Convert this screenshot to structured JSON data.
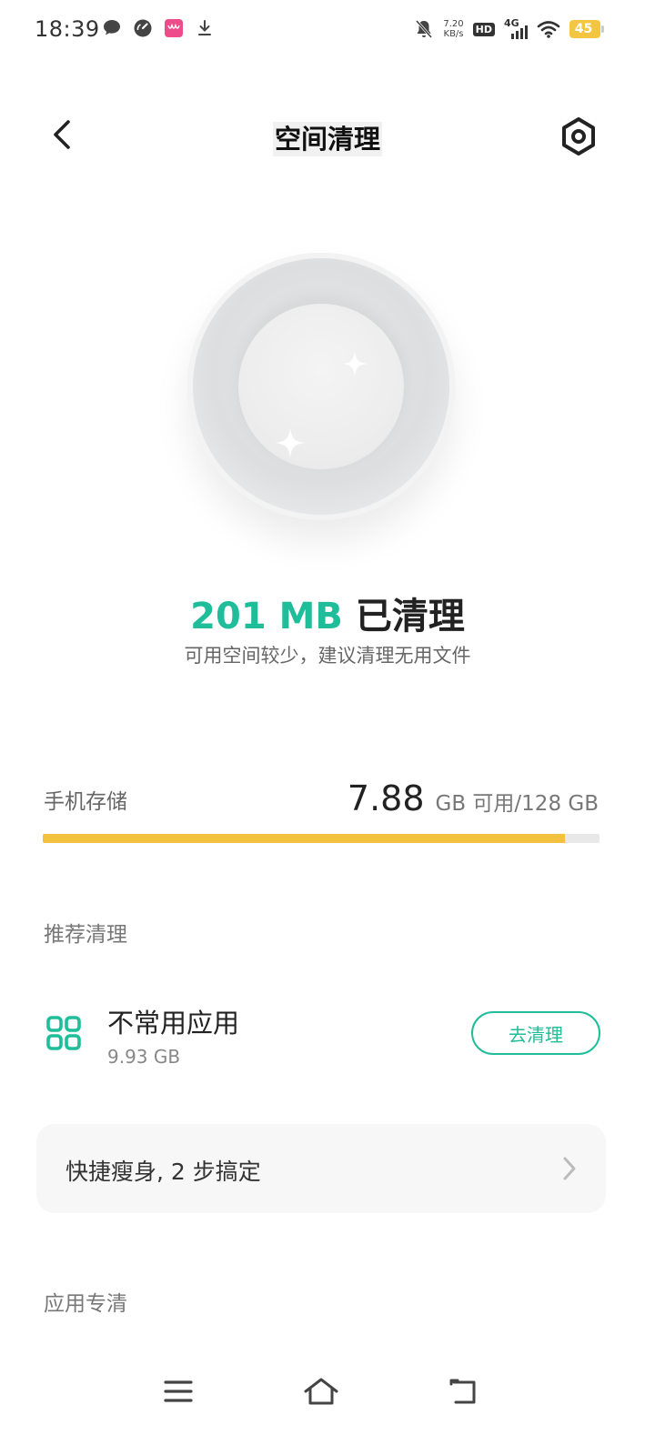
{
  "status_bar": {
    "time": "18:39",
    "speed_value": "7.20",
    "speed_unit": "KB/s",
    "hd": "HD",
    "network": "4G",
    "battery": "45",
    "left_icons": [
      "message-icon",
      "gauge-icon",
      "app-notification-icon",
      "download-icon"
    ],
    "right_icons": [
      "mute-icon",
      "hd-icon",
      "signal-icon",
      "wifi-icon",
      "battery-icon"
    ]
  },
  "header": {
    "title": "空间清理",
    "back_icon": "back-arrow-icon",
    "settings_icon": "settings-icon"
  },
  "summary": {
    "amount": "201 MB",
    "suffix": "已清理",
    "hint": "可用空间较少，建议清理无用文件"
  },
  "storage": {
    "label": "手机存储",
    "free": "7.88",
    "unit_text": "GB 可用/128 GB",
    "used_fraction": 0.938
  },
  "recommend": {
    "section_label": "推荐清理",
    "item": {
      "title": "不常用应用",
      "size": "9.93 GB",
      "button": "去清理",
      "icon": "apps-grid-icon"
    },
    "quick": {
      "text": "快捷瘦身, 2 步搞定",
      "icon": "chevron-right-icon"
    }
  },
  "app_clean": {
    "section_label": "应用专清"
  },
  "nav": {
    "icons": [
      "menu-icon",
      "home-icon",
      "back-icon"
    ]
  },
  "colors": {
    "accent": "#1fbd99",
    "storage_bar": "#f2c23f",
    "battery": "#f4c541"
  }
}
